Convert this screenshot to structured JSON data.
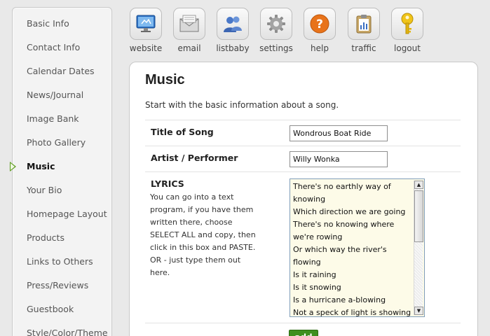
{
  "sidebar": {
    "items": [
      {
        "label": "Basic Info"
      },
      {
        "label": "Contact Info"
      },
      {
        "label": "Calendar Dates"
      },
      {
        "label": "News/Journal"
      },
      {
        "label": "Image Bank"
      },
      {
        "label": "Photo Gallery"
      },
      {
        "label": "Music"
      },
      {
        "label": "Your Bio"
      },
      {
        "label": "Homepage Layout"
      },
      {
        "label": "Products"
      },
      {
        "label": "Links to Others"
      },
      {
        "label": "Press/Reviews"
      },
      {
        "label": "Guestbook"
      },
      {
        "label": "Style/Color/Theme"
      }
    ],
    "active": "Music"
  },
  "toolbar": {
    "items": [
      {
        "label": "website",
        "icon": "monitor-icon"
      },
      {
        "label": "email",
        "icon": "envelope-icon"
      },
      {
        "label": "listbaby",
        "icon": "people-icon"
      },
      {
        "label": "settings",
        "icon": "gear-icon"
      },
      {
        "label": "help",
        "icon": "question-icon"
      },
      {
        "label": "traffic",
        "icon": "clipboard-icon"
      },
      {
        "label": "logout",
        "icon": "key-icon"
      }
    ]
  },
  "main": {
    "title": "Music",
    "intro": "Start with the basic information about a song.",
    "fields": {
      "title_label": "Title of Song",
      "title_value": "Wondrous Boat Ride",
      "artist_label": "Artist / Performer",
      "artist_value": "Willy Wonka",
      "lyrics_label": "LYRICS",
      "lyrics_help": "You can go into a text program, if you have them written there, choose SELECT ALL and copy, then click in this box and PASTE. OR - just type them out here.",
      "lyrics_value": "There's no earthly way of knowing\nWhich direction we are going\nThere's no knowing where we're rowing\nOr which way the river's flowing\nIs it raining\nIs it snowing\nIs a hurricane a-blowing\nNot a speck of light is showing\nSo the danger must be"
    },
    "add_label": "add"
  },
  "colors": {
    "accent": "#3f8f1f",
    "active_arrow": "#5a9a1a",
    "lyrics_bg": "#fdfbe8"
  }
}
